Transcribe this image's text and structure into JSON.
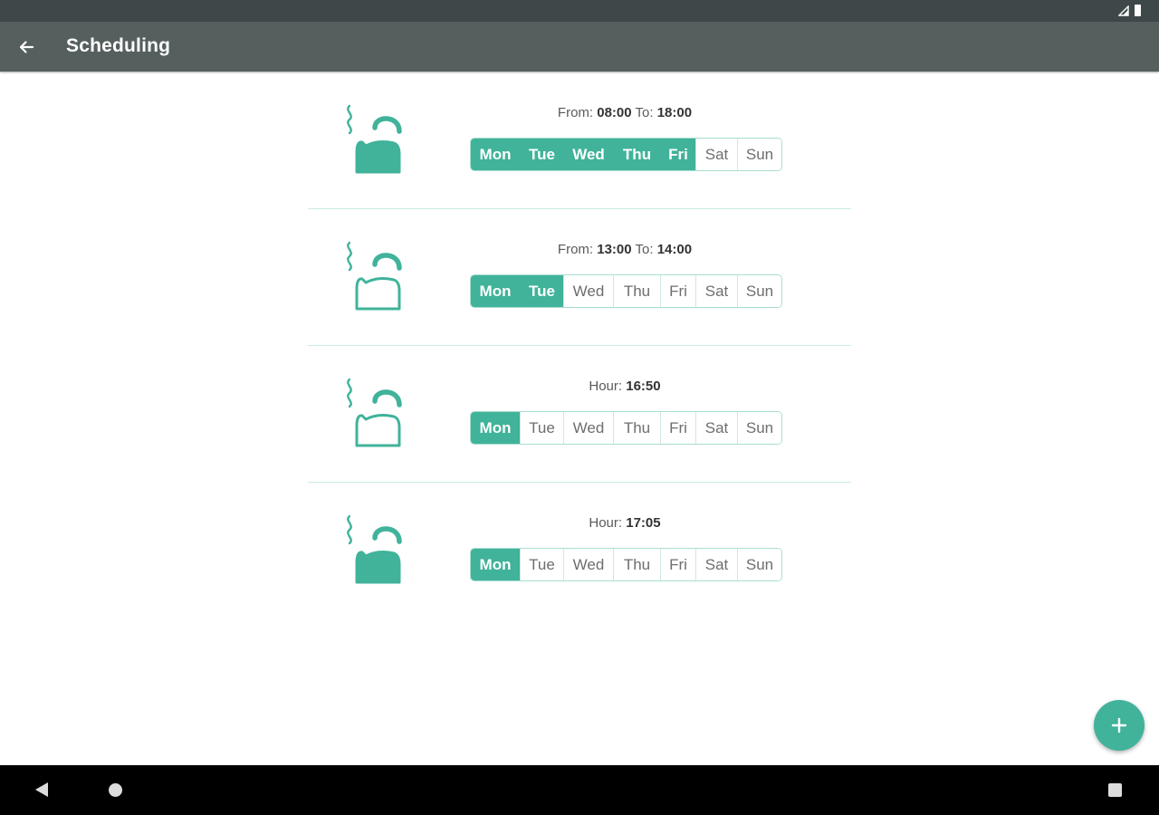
{
  "app_bar": {
    "title": "Scheduling"
  },
  "icons": {
    "back": "arrow-back-icon",
    "kettle": "kettle-icon",
    "add": "plus-icon",
    "signal": "signal-icon",
    "battery": "battery-icon"
  },
  "colors": {
    "accent": "#40b39a",
    "toolbar": "#555f5e",
    "status_bar": "#3e4849"
  },
  "schedules": [
    {
      "mode": "range",
      "label_a": "From: ",
      "value_a": "08:00",
      "label_b": " To: ",
      "value_b": "18:00",
      "kettle_filled": true,
      "days": [
        {
          "label": "Mon",
          "active": true
        },
        {
          "label": "Tue",
          "active": true
        },
        {
          "label": "Wed",
          "active": true
        },
        {
          "label": "Thu",
          "active": true
        },
        {
          "label": "Fri",
          "active": true
        },
        {
          "label": "Sat",
          "active": false
        },
        {
          "label": "Sun",
          "active": false
        }
      ]
    },
    {
      "mode": "range",
      "label_a": "From: ",
      "value_a": "13:00",
      "label_b": " To: ",
      "value_b": "14:00",
      "kettle_filled": false,
      "days": [
        {
          "label": "Mon",
          "active": true
        },
        {
          "label": "Tue",
          "active": true
        },
        {
          "label": "Wed",
          "active": false
        },
        {
          "label": "Thu",
          "active": false
        },
        {
          "label": "Fri",
          "active": false
        },
        {
          "label": "Sat",
          "active": false
        },
        {
          "label": "Sun",
          "active": false
        }
      ]
    },
    {
      "mode": "hour",
      "label_a": "Hour: ",
      "value_a": "16:50",
      "kettle_filled": false,
      "days": [
        {
          "label": "Mon",
          "active": true
        },
        {
          "label": "Tue",
          "active": false
        },
        {
          "label": "Wed",
          "active": false
        },
        {
          "label": "Thu",
          "active": false
        },
        {
          "label": "Fri",
          "active": false
        },
        {
          "label": "Sat",
          "active": false
        },
        {
          "label": "Sun",
          "active": false
        }
      ]
    },
    {
      "mode": "hour",
      "label_a": "Hour: ",
      "value_a": "17:05",
      "kettle_filled": true,
      "days": [
        {
          "label": "Mon",
          "active": true
        },
        {
          "label": "Tue",
          "active": false
        },
        {
          "label": "Wed",
          "active": false
        },
        {
          "label": "Thu",
          "active": false
        },
        {
          "label": "Fri",
          "active": false
        },
        {
          "label": "Sat",
          "active": false
        },
        {
          "label": "Sun",
          "active": false
        }
      ]
    }
  ]
}
